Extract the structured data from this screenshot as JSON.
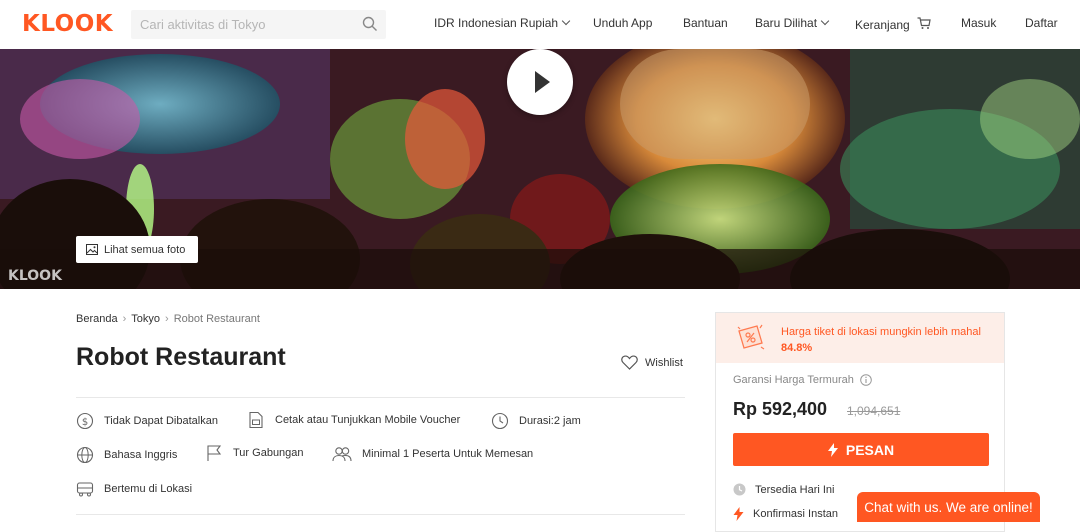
{
  "header": {
    "logo": "KLOOK",
    "search_placeholder": "Cari aktivitas di Tokyo",
    "currency": "IDR  Indonesian Rupiah",
    "download": "Unduh App",
    "help": "Bantuan",
    "recent": "Baru Dilihat",
    "cart": "Keranjang",
    "login": "Masuk",
    "signup": "Daftar"
  },
  "hero": {
    "all_photos": "Lihat semua foto",
    "watermark": "KLOOK"
  },
  "breadcrumb": {
    "home": "Beranda",
    "city": "Tokyo",
    "current": "Robot Restaurant"
  },
  "title": "Robot Restaurant",
  "wishlist": "Wishlist",
  "features": {
    "cancel": "Tidak Dapat Dibatalkan",
    "voucher": "Cetak atau Tunjukkan Mobile Voucher",
    "duration": "Durasi:2 jam",
    "language": "Bahasa Inggris",
    "tour": "Tur Gabungan",
    "min": "Minimal 1 Peserta Untuk Memesan",
    "meet": "Bertemu di Lokasi"
  },
  "booking": {
    "promo_text": "Harga tiket di lokasi mungkin lebih mahal",
    "promo_pct": "84.8%",
    "guarantee": "Garansi Harga Termurah",
    "price": "Rp 592,400",
    "old_price": "1,094,651",
    "book": "PESAN",
    "avail_today": "Tersedia Hari Ini",
    "instant": "Konfirmasi Instan"
  },
  "chat": "Chat with us. We are online!",
  "colors": {
    "brand": "#ff5722",
    "promo_bg": "#fdeee8"
  }
}
